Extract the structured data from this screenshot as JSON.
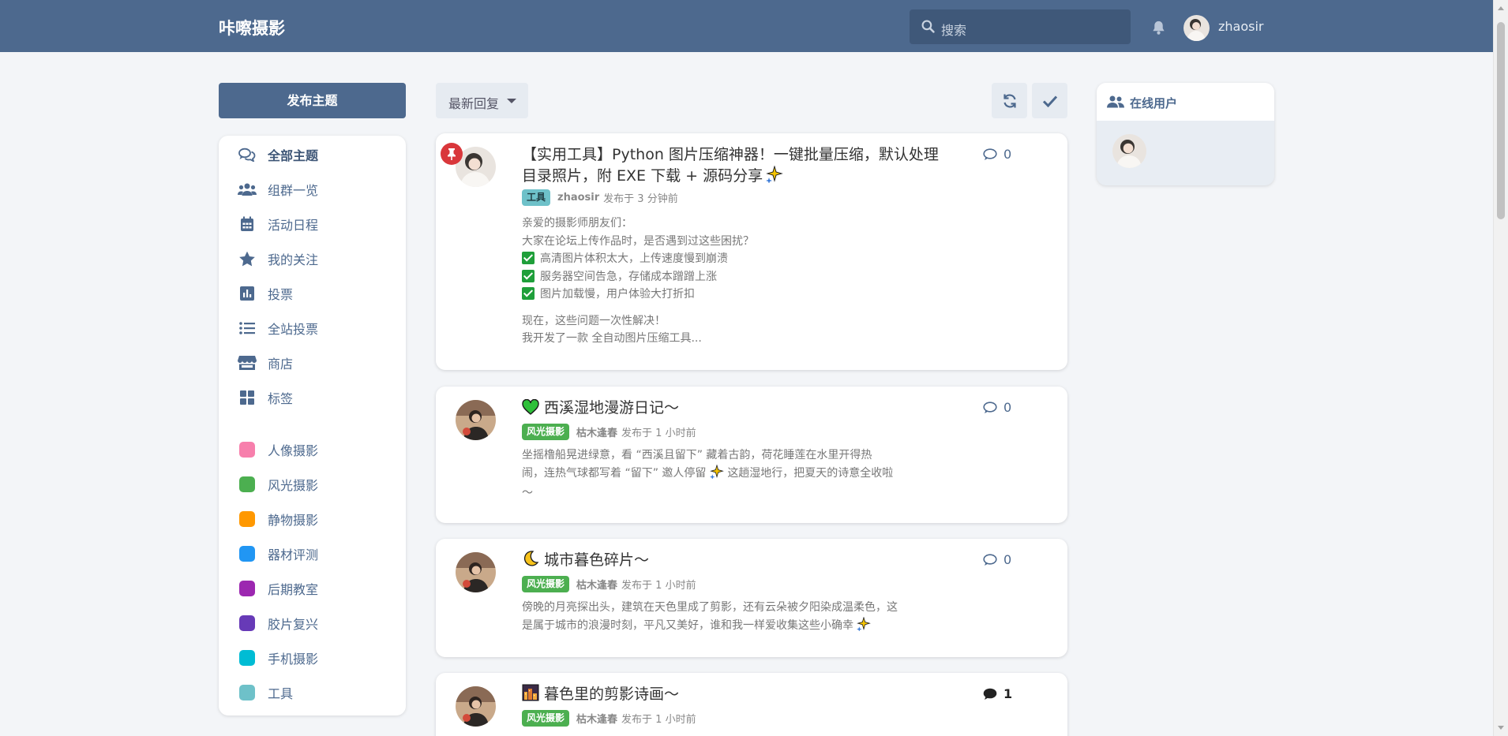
{
  "header": {
    "site_title": "咔嚓摄影",
    "search_placeholder": "搜索",
    "username": "zhaosir"
  },
  "sidebar": {
    "new_topic_label": "发布主题",
    "nav": [
      {
        "label": "全部主题",
        "icon": "comments-icon"
      },
      {
        "label": "组群一览",
        "icon": "users-icon"
      },
      {
        "label": "活动日程",
        "icon": "calendar-icon"
      },
      {
        "label": "我的关注",
        "icon": "star-icon"
      },
      {
        "label": "投票",
        "icon": "poll-icon"
      },
      {
        "label": "全站投票",
        "icon": "list-icon"
      },
      {
        "label": "商店",
        "icon": "store-icon"
      },
      {
        "label": "标签",
        "icon": "tags-grid-icon"
      }
    ],
    "tags": [
      {
        "label": "人像摄影",
        "color": "#f77fac"
      },
      {
        "label": "风光摄影",
        "color": "#4caf50"
      },
      {
        "label": "静物摄影",
        "color": "#ff9800"
      },
      {
        "label": "器材评测",
        "color": "#2196f3"
      },
      {
        "label": "后期教室",
        "color": "#9c27b0"
      },
      {
        "label": "胶片复兴",
        "color": "#673ab7"
      },
      {
        "label": "手机摄影",
        "color": "#00bcd4"
      },
      {
        "label": "工具",
        "color": "#6ec1c9"
      }
    ]
  },
  "toolbar": {
    "sort_label": "最新回复"
  },
  "discussions": [
    {
      "title": "【实用工具】Python 图片压缩神器！一键批量压缩，默认处理目录照片，附 EXE 下载 + 源码分享",
      "title_emoji": "sparkle",
      "pinned": true,
      "tag": {
        "label": "工具",
        "bg": "#6ec1c9",
        "fg": "#1e3a40"
      },
      "author": "zhaosir",
      "posted": "发布于 3 分钟前",
      "replies": "0",
      "excerpt_lines": [
        "亲爱的摄影师朋友们：",
        "大家在论坛上传作品时，是否遇到过这些困扰？",
        "高清图片体积太大，上传速度慢到崩溃",
        "服务器空间告急，存储成本蹭蹭上涨",
        "图片加载慢，用户体验大打折扣",
        "现在，这些问题一次性解决！",
        "我开发了一款 全自动图片压缩工具..."
      ]
    },
    {
      "title": "西溪湿地漫游日记～",
      "title_emoji": "green-heart",
      "pinned": false,
      "tag": {
        "label": "风光摄影",
        "bg": "#4caf50",
        "fg": "#ffffff"
      },
      "author": "枯木逢春",
      "posted": "发布于 1 小时前",
      "replies": "0",
      "excerpt_lines": [
        "坐摇橹船晃进绿意，看 “西溪且留下” 藏着古韵，荷花睡莲在水里开得热",
        "闹，连热气球都写着 “留下” 邀人停留",
        "这趟湿地行，把夏天的诗意全收啦",
        "～"
      ]
    },
    {
      "title": "城市暮色碎片～",
      "title_emoji": "moon",
      "pinned": false,
      "tag": {
        "label": "风光摄影",
        "bg": "#4caf50",
        "fg": "#ffffff"
      },
      "author": "枯木逢春",
      "posted": "发布于 1 小时前",
      "replies": "0",
      "excerpt_lines": [
        "傍晚的月亮探出头，建筑在天色里成了剪影，还有云朵被夕阳染成温柔色，这",
        "是属于城市的浪漫时刻，平凡又美好，谁和我一样爱收集这些小确幸"
      ]
    },
    {
      "title": "暮色里的剪影诗画～",
      "title_emoji": "night-city",
      "pinned": false,
      "tag": {
        "label": "风光摄影",
        "bg": "#4caf50",
        "fg": "#ffffff"
      },
      "author": "枯木逢春",
      "posted": "发布于 1 小时前",
      "replies": "1"
    }
  ],
  "online": {
    "title": "在线用户"
  }
}
